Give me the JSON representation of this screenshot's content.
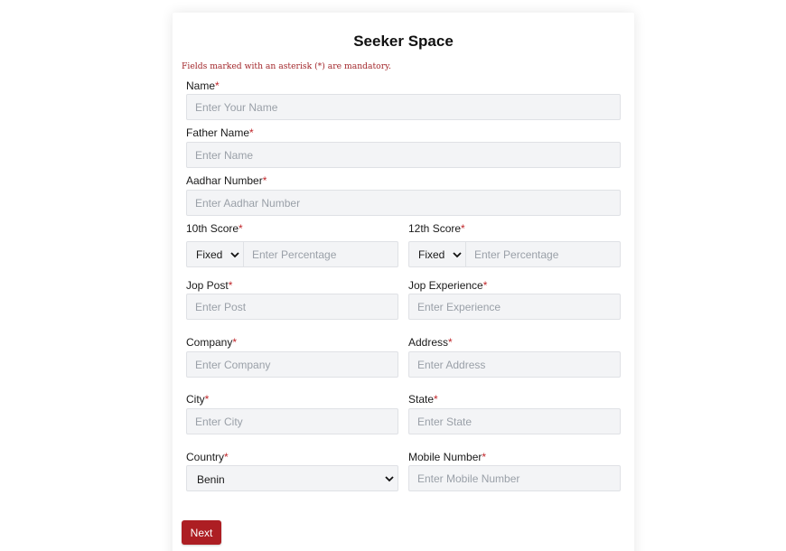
{
  "form": {
    "title": "Seeker Space",
    "note": "Fields marked with an asterisk (*) are mandatory.",
    "required_mark": "*",
    "name": {
      "label": "Name",
      "placeholder": "Enter Your Name"
    },
    "father_name": {
      "label": "Father Name",
      "placeholder": "Enter Name"
    },
    "aadhar": {
      "label": "Aadhar Number",
      "placeholder": "Enter Aadhar Number"
    },
    "score10": {
      "label": "10th Score",
      "type_value": "Fixed",
      "placeholder": "Enter Percentage"
    },
    "score12": {
      "label": "12th Score",
      "type_value": "Fixed",
      "placeholder": "Enter Percentage"
    },
    "job_post": {
      "label": "Jop Post",
      "placeholder": "Enter Post"
    },
    "job_experience": {
      "label": "Jop Experience",
      "placeholder": "Enter Experience"
    },
    "company": {
      "label": "Company",
      "placeholder": "Enter Company"
    },
    "address": {
      "label": "Address",
      "placeholder": "Enter Address"
    },
    "city": {
      "label": "City",
      "placeholder": "Enter City"
    },
    "state": {
      "label": "State",
      "placeholder": "Enter State"
    },
    "country": {
      "label": "Country",
      "value": "Benin"
    },
    "mobile": {
      "label": "Mobile Number",
      "placeholder": "Enter Mobile Number"
    },
    "next_label": "Next"
  },
  "colors": {
    "accent": "#ad1e23",
    "required": "#c0262a",
    "input_bg": "#f3f4f6"
  }
}
